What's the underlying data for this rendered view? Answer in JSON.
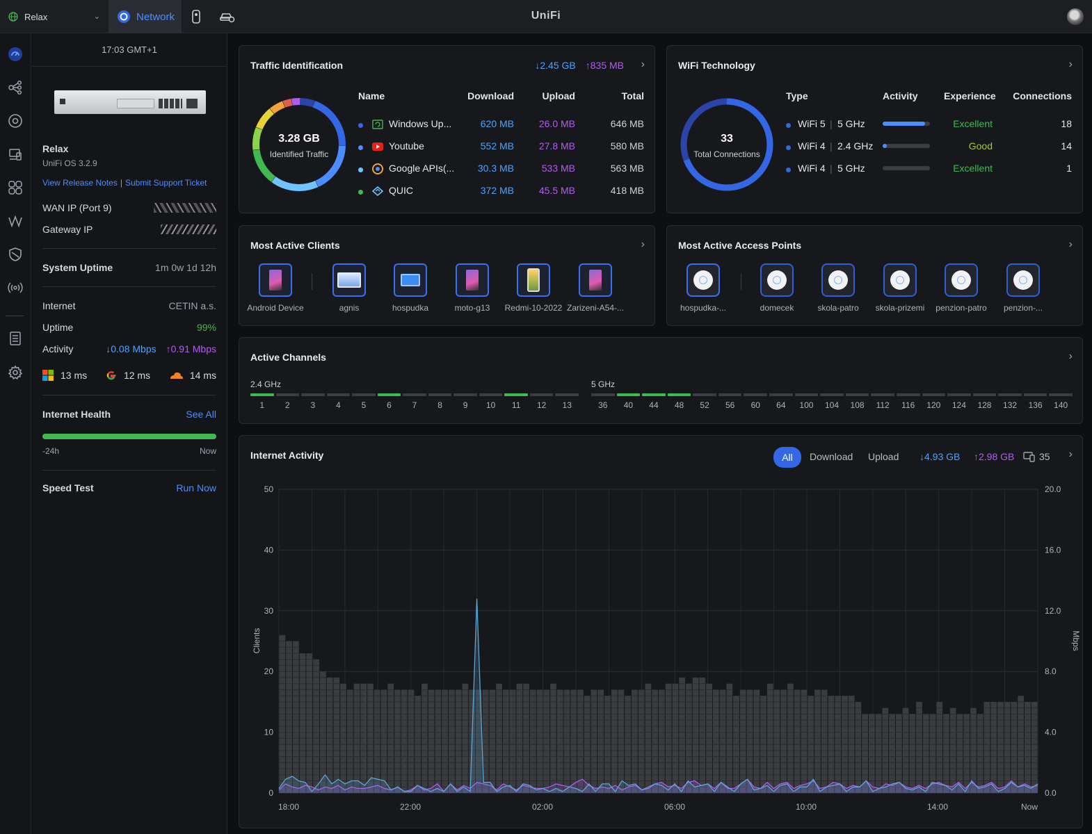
{
  "topbar": {
    "site": "Relax",
    "app_tab": "Network",
    "brand": "UniFi"
  },
  "sidebar": {
    "time": "17:03 GMT+1",
    "device_name": "Relax",
    "os": "UniFi OS 3.2.9",
    "release_notes": "View Release Notes",
    "divider": "|",
    "support": "Submit Support Ticket",
    "wan_ip_label": "WAN IP (Port 9)",
    "gateway_ip_label": "Gateway IP",
    "uptime_title": "System Uptime",
    "uptime_value": "1m 0w 1d 12h",
    "internet_label": "Internet",
    "internet_value": "CETIN a.s.",
    "uptime_label": "Uptime",
    "uptime_pct": "99%",
    "activity_label": "Activity",
    "activity_down": "↓0.08 Mbps",
    "activity_up": "↑0.91 Mbps",
    "latency": [
      {
        "icon": "microsoft-icon",
        "value": "13 ms"
      },
      {
        "icon": "google-icon",
        "value": "12 ms"
      },
      {
        "icon": "cloudflare-icon",
        "value": "14 ms"
      }
    ],
    "health_title": "Internet Health",
    "health_link": "See All",
    "health_pct": 100,
    "health_start": "-24h",
    "health_end": "Now",
    "speed_title": "Speed Test",
    "speed_link": "Run Now"
  },
  "traffic": {
    "title": "Traffic Identification",
    "down": "↓2.45 GB",
    "up": "↑835 MB",
    "total": "3.28 GB",
    "total_label": "Identified Traffic",
    "headers": [
      "Name",
      "Download",
      "Upload",
      "Total"
    ],
    "rows": [
      {
        "name": "Windows Up...",
        "download": "620 MB",
        "upload": "26.0 MB",
        "total": "646 MB",
        "dot": "#3467e4",
        "icon": "windows-update-icon"
      },
      {
        "name": "Youtube",
        "download": "552 MB",
        "upload": "27.8 MB",
        "total": "580 MB",
        "dot": "#4c8dff",
        "icon": "youtube-icon"
      },
      {
        "name": "Google APIs(...",
        "download": "30.3 MB",
        "upload": "533 MB",
        "total": "563 MB",
        "dot": "#6fc3ff",
        "icon": "google-apis-icon"
      },
      {
        "name": "QUIC",
        "download": "372 MB",
        "upload": "45.5 MB",
        "total": "418 MB",
        "dot": "#3fb950",
        "icon": "quic-icon"
      }
    ]
  },
  "wifi": {
    "title": "WiFi Technology",
    "total": "33",
    "total_label": "Total Connections",
    "headers": [
      "Type",
      "Activity",
      "Experience",
      "Connections"
    ],
    "rows": [
      {
        "standard": "WiFi 5",
        "band": "5 GHz",
        "activity": 0.9,
        "experience": "Excellent",
        "connections": "18"
      },
      {
        "standard": "WiFi 4",
        "band": "2.4 GHz",
        "activity": 0.06,
        "experience": "Good",
        "connections": "14"
      },
      {
        "standard": "WiFi 4",
        "band": "5 GHz",
        "activity": 0.0,
        "experience": "Excellent",
        "connections": "1"
      }
    ],
    "sep": "|"
  },
  "clients": {
    "title": "Most Active Clients",
    "items": [
      "Android Device",
      "agnis",
      "hospudka",
      "moto-g13",
      "Redmi-10-2022",
      "Zarizeni-A54-..."
    ]
  },
  "aps": {
    "title": "Most Active Access Points",
    "items": [
      "hospudka-...",
      "domecek",
      "skola-patro",
      "skola-prizemi",
      "penzion-patro",
      "penzion-..."
    ]
  },
  "channels": {
    "title": "Active Channels",
    "band24": "2.4 GHz",
    "band5": "5 GHz",
    "ch24": [
      "1",
      "2",
      "3",
      "4",
      "5",
      "6",
      "7",
      "8",
      "9",
      "10",
      "11",
      "12",
      "13"
    ],
    "active24": [
      "1",
      "6",
      "11"
    ],
    "ch5": [
      "36",
      "40",
      "44",
      "48",
      "52",
      "56",
      "60",
      "64",
      "100",
      "104",
      "108",
      "112",
      "116",
      "120",
      "124",
      "128",
      "132",
      "136",
      "140"
    ],
    "active5": [
      "40",
      "44",
      "48"
    ]
  },
  "activity": {
    "title": "Internet Activity",
    "filters": [
      "All",
      "Download",
      "Upload"
    ],
    "selected": "All",
    "down": "↓4.93 GB",
    "up": "↑2.98 GB",
    "clients": "35"
  },
  "chart_data": {
    "type": "bar",
    "xlabel": "",
    "ylabel": "Clients",
    "ylabel_right": "Mbps",
    "ylim": [
      0,
      50
    ],
    "ylim_right": [
      0,
      20
    ],
    "yticks": [
      "0",
      "10",
      "20",
      "30",
      "40",
      "50"
    ],
    "yticks_right": [
      "0.0",
      "4.0",
      "8.0",
      "12.0",
      "16.0",
      "20.0"
    ],
    "xticks": [
      "18:00",
      "22:00",
      "02:00",
      "06:00",
      "10:00",
      "14:00",
      "Now"
    ],
    "series": [
      {
        "name": "Clients",
        "values": [
          26,
          25,
          25,
          23,
          23,
          22,
          20,
          19,
          19,
          18,
          17,
          18,
          18,
          18,
          17,
          17,
          18,
          17,
          17,
          17,
          16,
          18,
          17,
          17,
          17,
          17,
          17,
          18,
          17,
          17,
          17,
          17,
          18,
          17,
          17,
          18,
          18,
          17,
          17,
          17,
          18,
          17,
          17,
          17,
          17,
          16,
          17,
          17,
          16,
          17,
          17,
          16,
          17,
          17,
          18,
          17,
          17,
          18,
          18,
          19,
          18,
          19,
          19,
          18,
          17,
          17,
          18,
          16,
          17,
          17,
          17,
          16,
          18,
          17,
          17,
          18,
          17,
          17,
          16,
          17,
          17,
          16,
          16,
          16,
          16,
          15,
          13,
          13,
          13,
          14,
          13,
          13,
          14,
          13,
          15,
          13,
          13,
          15,
          13,
          14,
          13,
          13,
          14,
          13,
          15,
          15,
          15,
          15,
          15,
          16,
          15,
          15
        ]
      },
      {
        "name": "Download",
        "values": [
          0.3,
          0.9,
          1.1,
          0.8,
          0.7,
          0.1,
          0.6,
          1.2,
          0.6,
          0.9,
          0.6,
          0.8,
          0.8,
          0.5,
          1.0,
          0.9,
          0.8,
          0.2,
          0.4,
          0.1,
          0.1,
          0.5,
          0.3,
          0.1,
          0.3,
          0.1,
          0.6,
          0.1,
          0.4,
          0.1,
          0.8,
          0.7,
          0.7,
          0.1,
          0.4,
          0.5,
          0.1,
          0.6,
          0.5,
          0.2,
          0.3,
          0.1,
          0.3,
          0.1,
          0.4,
          0.3,
          0.1,
          0.6,
          0.1,
          0.6,
          0.6,
          0.1,
          0.8,
          0.5,
          0.6,
          0.2,
          0.4,
          0.6,
          0.5,
          0.2,
          0.6,
          0.1,
          0.8,
          0.4,
          0.5,
          0.6,
          0.1,
          0.7,
          0.4,
          0.1,
          0.6,
          0.9,
          0.2,
          0.3,
          0.5,
          0.1,
          0.5,
          0.6,
          0.1,
          0.4,
          0.4,
          0.9,
          0.1,
          0.4,
          0.5,
          0.6,
          0.1,
          0.4,
          0.4,
          0.8,
          0.1,
          0.3,
          0.4,
          0.6,
          0.7,
          0.3,
          0.2,
          0.4,
          0.1,
          0.7,
          0.6,
          0.5,
          0.2,
          0.6,
          0.1,
          0.8,
          0.3,
          0.4,
          0.6,
          0.1,
          0.3,
          0.7,
          0.4,
          0.5,
          0.3,
          0.6
        ]
      },
      {
        "name": "Upload",
        "values": [
          0.2,
          0.6,
          0.4,
          0.3,
          0.5,
          0.4,
          0.2,
          0.4,
          0.3,
          0.5,
          0.2,
          0.4,
          0.3,
          0.3,
          0.4,
          0.5,
          0.3,
          0.2,
          0.4,
          0.1,
          0.2,
          0.5,
          0.2,
          0.3,
          0.6,
          0.1,
          0.6,
          0.2,
          0.5,
          0.3,
          0.7,
          0.6,
          0.5,
          0.2,
          0.6,
          0.4,
          0.2,
          0.5,
          0.4,
          0.3,
          0.3,
          0.4,
          0.6,
          0.5,
          0.4,
          0.7,
          0.9,
          0.5,
          0.3,
          0.4,
          0.3,
          0.5,
          0.2,
          0.4,
          0.5,
          0.2,
          0.3,
          0.6,
          0.7,
          0.4,
          0.5,
          0.3,
          0.7,
          0.8,
          0.5,
          0.6,
          0.3,
          0.7,
          0.3,
          0.3,
          0.6,
          0.9,
          0.4,
          0.3,
          0.7,
          0.3,
          0.6,
          0.7,
          0.3,
          0.5,
          0.6,
          0.8,
          0.3,
          0.4,
          0.7,
          0.6,
          0.3,
          0.5,
          0.4,
          0.8,
          0.4,
          0.3,
          0.6,
          0.5,
          0.7,
          0.4,
          0.3,
          0.5,
          0.3,
          0.6,
          0.7,
          0.5,
          0.4,
          0.7,
          0.3,
          0.7,
          0.4,
          0.5,
          0.7,
          0.3,
          0.4,
          0.8,
          0.4,
          0.6,
          0.4,
          0.5
        ]
      }
    ],
    "spike": {
      "series": "Download",
      "x": "~01:15",
      "value": 12.8
    }
  }
}
